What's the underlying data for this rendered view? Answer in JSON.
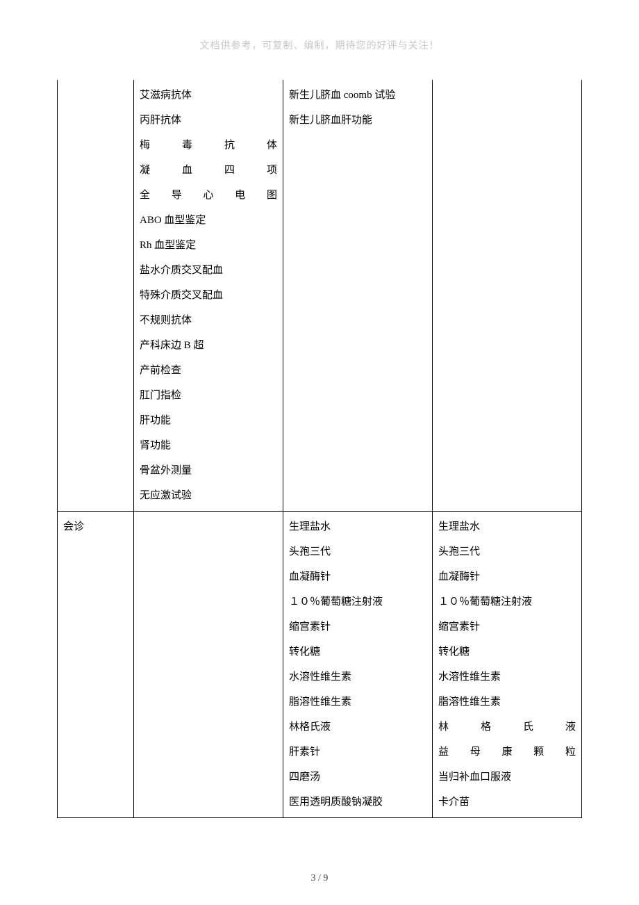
{
  "header_note": "文档供参考，可复制、编制，期待您的好评与关注！",
  "page_number": "3 / 9",
  "row1": {
    "col1": "",
    "col2": [
      "艾滋病抗体",
      "丙肝抗体",
      {
        "justify": true,
        "text": "梅毒抗体"
      },
      {
        "justify": true,
        "text": "凝血四项"
      },
      {
        "justify": true,
        "text": "全导心电图"
      },
      "ABO 血型鉴定",
      "Rh 血型鉴定",
      "盐水介质交叉配血",
      "特殊介质交叉配血",
      "不规则抗体",
      "产科床边 B 超",
      "产前检查",
      "肛门指检",
      "肝功能",
      "肾功能",
      "骨盆外测量",
      "无应激试验"
    ],
    "col3": [
      "新生儿脐血 coomb 试验",
      "新生儿脐血肝功能"
    ],
    "col4": []
  },
  "row2": {
    "col1": "会诊",
    "col2": [],
    "col3": [
      "生理盐水",
      "头孢三代",
      "血凝酶针",
      "１０％葡萄糖注射液",
      "缩宫素针",
      "转化糖",
      "水溶性维生素",
      "脂溶性维生素",
      "林格氏液",
      "肝素针",
      "四磨汤",
      "医用透明质酸钠凝胶"
    ],
    "col4": [
      "生理盐水",
      "头孢三代",
      "血凝酶针",
      "１０％葡萄糖注射液",
      "缩宫素针",
      "转化糖",
      "水溶性维生素",
      "脂溶性维生素",
      {
        "justify": true,
        "text": "林格氏液"
      },
      {
        "justify": true,
        "text": "益母康颗粒"
      },
      "当归补血口服液",
      "卡介苗"
    ]
  }
}
